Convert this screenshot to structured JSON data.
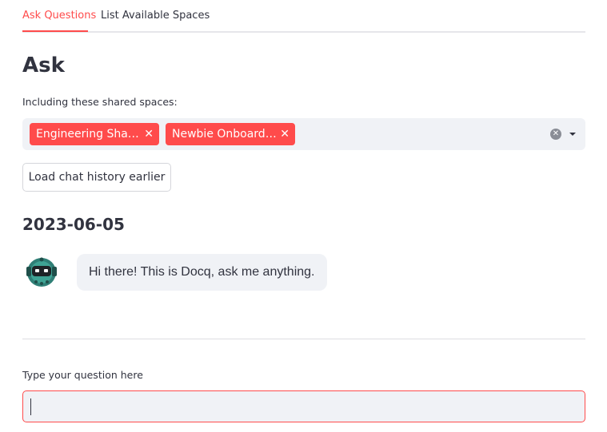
{
  "tabs": [
    {
      "label": "Ask Questions",
      "active": true
    },
    {
      "label": "List Available Spaces",
      "active": false
    }
  ],
  "page": {
    "title": "Ask",
    "spaces_label": "Including these shared spaces:"
  },
  "selected_spaces": [
    {
      "label": "Engineering Sha…"
    },
    {
      "label": "Newbie Onboard…"
    }
  ],
  "history_button": "Load chat history earlier",
  "chat": {
    "date": "2023-06-05",
    "messages": [
      {
        "sender": "bot",
        "avatar_icon": "robot-avatar-icon",
        "text": "Hi there! This is Docq, ask me anything."
      }
    ]
  },
  "question": {
    "label": "Type your question here",
    "value": ""
  },
  "colors": {
    "accent": "#ff4b4b",
    "surface": "#f0f2f6",
    "text": "#31333f"
  }
}
